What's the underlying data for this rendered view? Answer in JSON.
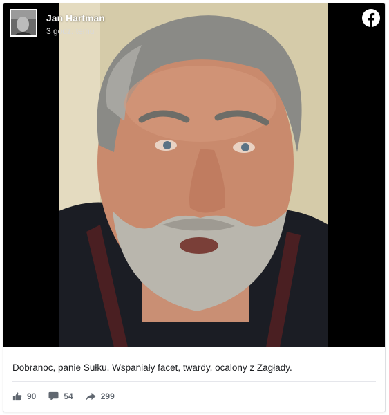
{
  "post": {
    "author": "Jan Hartman",
    "time": "3 godz. temu",
    "text": "Dobranoc, panie Sułku. Wspaniały facet, twardy, ocalony z Zagłady.",
    "platform_icon": "facebook-logo-icon"
  },
  "stats": {
    "likes": "90",
    "comments": "54",
    "shares": "299"
  },
  "icons": {
    "like": "thumbs-up-icon",
    "comment": "comment-bubble-icon",
    "share": "share-arrow-icon"
  },
  "colors": {
    "facebook_white": "#ffffff",
    "stat_gray": "#606770",
    "text": "#1c1e21"
  }
}
